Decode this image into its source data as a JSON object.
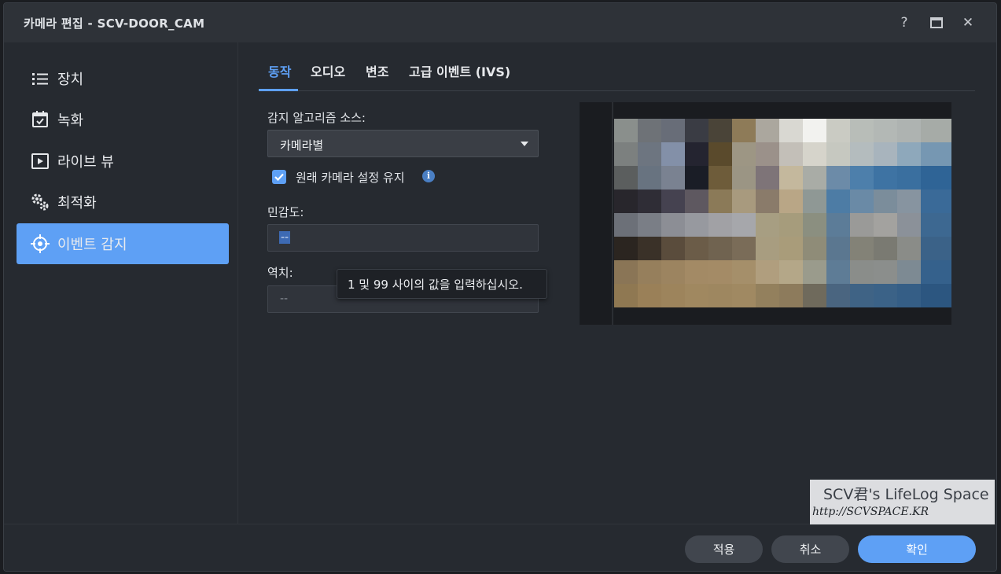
{
  "window": {
    "title": "카메라 편집 - SCV-DOOR_CAM",
    "help_glyph": "?",
    "close_glyph": "✕"
  },
  "sidebar": {
    "items": [
      {
        "label": "장치",
        "icon": "list-icon",
        "active": false
      },
      {
        "label": "녹화",
        "icon": "calendar-check-icon",
        "active": false
      },
      {
        "label": "라이브 뷰",
        "icon": "play-icon",
        "active": false
      },
      {
        "label": "최적화",
        "icon": "gears-icon",
        "active": false
      },
      {
        "label": "이벤트 감지",
        "icon": "crosshair-icon",
        "active": true
      }
    ]
  },
  "tabs": [
    {
      "label": "동작",
      "active": true
    },
    {
      "label": "오디오",
      "active": false
    },
    {
      "label": "변조",
      "active": false
    },
    {
      "label": "고급 이벤트 (IVS)",
      "active": false
    }
  ],
  "form": {
    "algorithm_label": "감지 알고리즘 소스:",
    "algorithm_value": "카메라별",
    "keep_settings_label": "원래 카메라 설정 유지",
    "keep_settings_checked": true,
    "info_glyph": "i",
    "sensitivity_label": "민감도:",
    "sensitivity_value": "--",
    "threshold_label": "역치:",
    "threshold_value": "--",
    "tooltip": "1 및 99 사이의 값을 입력하십시오."
  },
  "footer": {
    "apply_label": "적용",
    "cancel_label": "취소",
    "ok_label": "확인"
  },
  "watermark": {
    "line1": "SCV君's LifeLog Space",
    "line2": "http://SCVSPACE.KR"
  },
  "colors": {
    "accent": "#5ea0f5",
    "background": "#262a30"
  }
}
